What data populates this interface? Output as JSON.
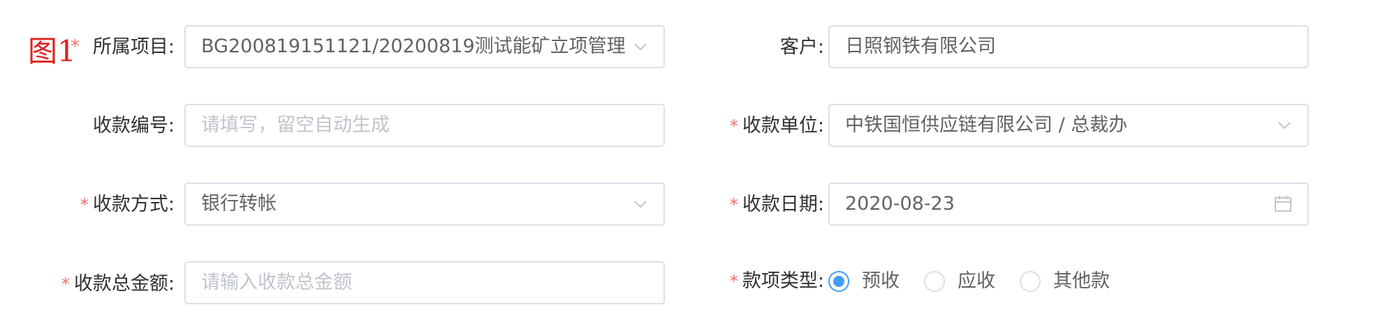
{
  "figure_label": "图1",
  "colon": ":",
  "form": {
    "project": {
      "label": "所属项目",
      "value": "BG200819151121/20200819测试能矿立项管理",
      "icon": "chevron-down-icon"
    },
    "customer": {
      "label": "客户",
      "value": "日照钢铁有限公司"
    },
    "receipt_no": {
      "label": "收款编号",
      "placeholder": "请填写，留空自动生成"
    },
    "receiving_unit": {
      "label": "收款单位",
      "value": "中铁国恒供应链有限公司 / 总裁办",
      "icon": "chevron-down-icon"
    },
    "payment_method": {
      "label": "收款方式",
      "value": "银行转帐",
      "icon": "chevron-down-icon"
    },
    "receipt_date": {
      "label": "收款日期",
      "value": "2020-08-23",
      "icon": "calendar-icon"
    },
    "total_amount": {
      "label": "收款总金额",
      "placeholder": "请输入收款总金额"
    },
    "payment_type": {
      "label": "款项类型",
      "options": [
        "预收",
        "应收",
        "其他款"
      ],
      "selected": "预收"
    }
  },
  "colors": {
    "required": "#f56c6c",
    "figure_label": "#e02020",
    "accent": "#409eff",
    "border": "#dcdfe6",
    "placeholder": "#c0c4cc"
  }
}
